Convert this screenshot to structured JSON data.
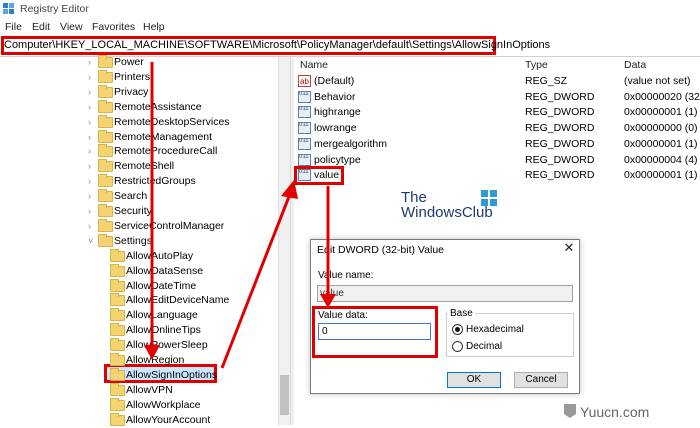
{
  "window": {
    "title": "Registry Editor"
  },
  "menu": [
    "File",
    "Edit",
    "View",
    "Favorites",
    "Help"
  ],
  "address": "Computer\\HKEY_LOCAL_MACHINE\\SOFTWARE\\Microsoft\\PolicyManager\\default\\Settings\\AllowSignInOptions",
  "tree": {
    "top_nodes": [
      "Power",
      "Printers",
      "Privacy",
      "RemoteAssistance",
      "RemoteDesktopServices",
      "RemoteManagement",
      "RemoteProcedureCall",
      "RemoteShell",
      "RestrictedGroups",
      "Search",
      "Security",
      "ServiceControlManager",
      "Settings"
    ],
    "settings_children": [
      "AllowAutoPlay",
      "AllowDataSense",
      "AllowDateTime",
      "AllowEditDeviceName",
      "AllowLanguage",
      "AllowOnlineTips",
      "AllowPowerSleep",
      "AllowRegion",
      "AllowSignInOptions",
      "AllowVPN",
      "AllowWorkplace",
      "AllowYourAccount"
    ],
    "selected": "AllowSignInOptions"
  },
  "list": {
    "columns": [
      "Name",
      "Type",
      "Data"
    ],
    "rows": [
      {
        "icon": "string-value-icon",
        "name": "(Default)",
        "type": "REG_SZ",
        "data": "(value not set)"
      },
      {
        "icon": "dword-value-icon",
        "name": "Behavior",
        "type": "REG_DWORD",
        "data": "0x00000020 (32)"
      },
      {
        "icon": "dword-value-icon",
        "name": "highrange",
        "type": "REG_DWORD",
        "data": "0x00000001 (1)"
      },
      {
        "icon": "dword-value-icon",
        "name": "lowrange",
        "type": "REG_DWORD",
        "data": "0x00000000 (0)"
      },
      {
        "icon": "dword-value-icon",
        "name": "mergealgorithm",
        "type": "REG_DWORD",
        "data": "0x00000001 (1)"
      },
      {
        "icon": "dword-value-icon",
        "name": "policytype",
        "type": "REG_DWORD",
        "data": "0x00000004 (4)"
      },
      {
        "icon": "dword-value-icon",
        "name": "value",
        "type": "REG_DWORD",
        "data": "0x00000001 (1)"
      }
    ]
  },
  "watermark": {
    "line1": "The",
    "line2": "WindowsClub"
  },
  "dialog": {
    "title": "Edit DWORD (32-bit) Value",
    "close": "✕",
    "value_name_label": "Value name:",
    "value_name": "value",
    "value_data_label": "Value data:",
    "value_data": "0",
    "base_label": "Base",
    "radio_hex": "Hexadecimal",
    "radio_dec": "Decimal",
    "ok": "OK",
    "cancel": "Cancel"
  },
  "site_mark": "Yuucn.com",
  "colors": {
    "annotation_red": "#e00000",
    "selection_blue": "#cce8ff",
    "folder_yellow": "#f5d370"
  }
}
